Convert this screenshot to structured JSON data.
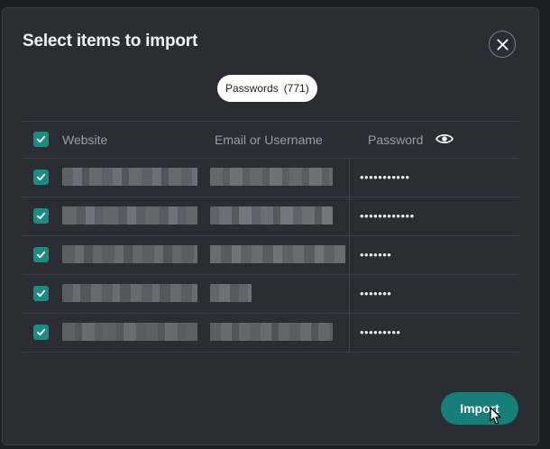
{
  "dialog": {
    "title": "Select items to import",
    "close_icon": "close-icon",
    "filter_pill": {
      "label": "Passwords",
      "count": "(771)"
    },
    "table": {
      "headers": {
        "website": "Website",
        "email": "Email or Username",
        "password": "Password"
      },
      "show_password_icon": "eye-icon",
      "rows": [
        {
          "password": "•••••••••••",
          "checked": true
        },
        {
          "password": "••••••••••••",
          "checked": true
        },
        {
          "password": "•••••••",
          "checked": true
        },
        {
          "password": "•••••••",
          "checked": true
        },
        {
          "password": "•••••••••",
          "checked": true
        }
      ]
    },
    "import_button": "Import"
  },
  "colors": {
    "accent": "#1a8c84",
    "button": "#167f78",
    "background": "#2a2d33"
  }
}
